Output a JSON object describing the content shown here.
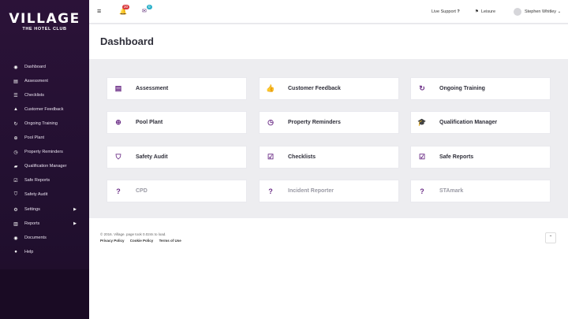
{
  "logo": {
    "brand": "VILLAGE",
    "sub": "THE HOTEL CLUB"
  },
  "sidebar": {
    "items": [
      {
        "label": "Dashboard",
        "icon": "dashboard-icon"
      },
      {
        "label": "Assessment",
        "icon": "document-icon"
      },
      {
        "label": "Checklists",
        "icon": "checklist-icon"
      },
      {
        "label": "Customer Feedback",
        "icon": "thumbs-up-icon"
      },
      {
        "label": "Ongoing Training",
        "icon": "refresh-icon"
      },
      {
        "label": "Pool Plant",
        "icon": "search-icon"
      },
      {
        "label": "Property Reminders",
        "icon": "clock-icon"
      },
      {
        "label": "Qualification Manager",
        "icon": "graduation-cap-icon"
      },
      {
        "label": "Safe Reports",
        "icon": "check-square-icon"
      },
      {
        "label": "Safety Audit",
        "icon": "shield-icon"
      },
      {
        "label": "Settings",
        "icon": "gear-icon"
      },
      {
        "label": "Reports",
        "icon": "bar-chart-icon"
      },
      {
        "label": "Documents",
        "icon": "file-icon"
      },
      {
        "label": "Help",
        "icon": "help-icon"
      }
    ]
  },
  "topbar": {
    "notif_count": "20",
    "mail_count": "0",
    "support": "Live Support",
    "leisure": "Leisure",
    "user": "Stephen Whitley"
  },
  "page": {
    "title": "Dashboard"
  },
  "tiles": [
    {
      "label": "Assessment",
      "icon": "document-icon",
      "glyph": "▤"
    },
    {
      "label": "Customer Feedback",
      "icon": "thumbs-up-icon",
      "glyph": "👍"
    },
    {
      "label": "Ongoing Training",
      "icon": "refresh-icon",
      "glyph": "↻"
    },
    {
      "label": "Pool Plant",
      "icon": "search-icon",
      "glyph": "⊕"
    },
    {
      "label": "Property Reminders",
      "icon": "clock-icon",
      "glyph": "◷"
    },
    {
      "label": "Qualification Manager",
      "icon": "graduation-cap-icon",
      "glyph": "🎓"
    },
    {
      "label": "Safety Audit",
      "icon": "shield-icon",
      "glyph": "⛉"
    },
    {
      "label": "Checklists",
      "icon": "checklist-icon",
      "glyph": "☑"
    },
    {
      "label": "Safe Reports",
      "icon": "check-square-icon",
      "glyph": "☑"
    },
    {
      "label": "CPD",
      "icon": "question-icon",
      "glyph": "?"
    },
    {
      "label": "Incident Reporter",
      "icon": "question-icon",
      "glyph": "?"
    },
    {
      "label": "STAmark",
      "icon": "question-icon",
      "glyph": "?"
    }
  ],
  "footer": {
    "copyright": "© 2016. Village. page took 0.024s to load.",
    "privacy": "Privacy Policy",
    "cookie": "Cookie Policy",
    "terms": "Terms of Use"
  },
  "colors": {
    "sidebar": "#2b1238",
    "accent": "#6b2d86",
    "badge_red": "#d9393e",
    "badge_cyan": "#2ab0c9"
  }
}
